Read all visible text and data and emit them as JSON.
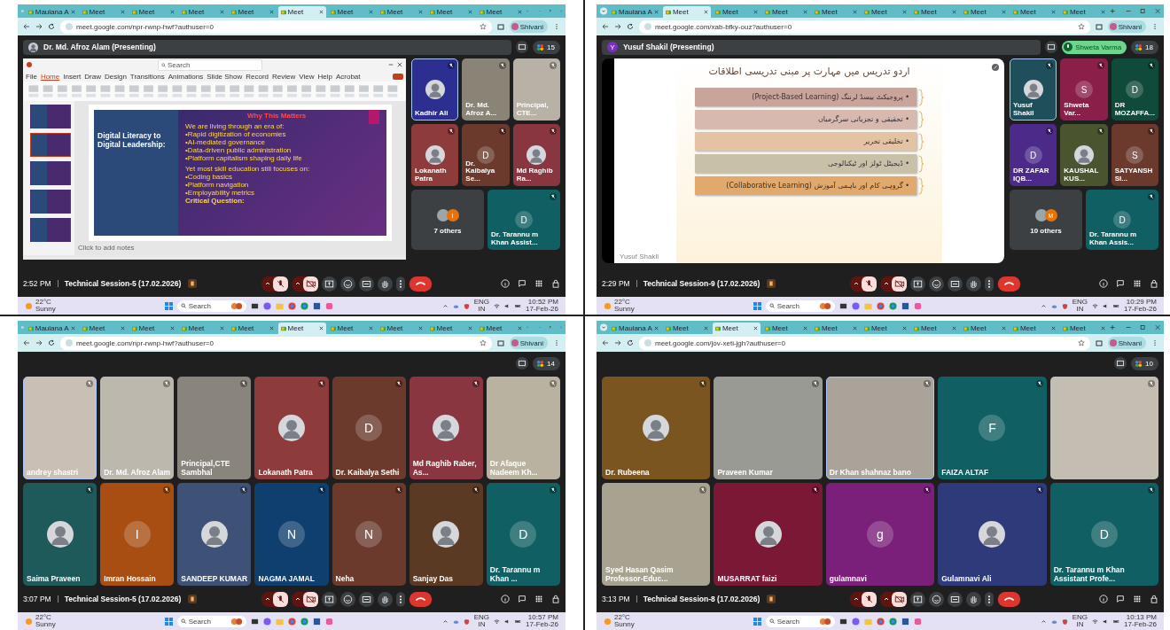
{
  "panels": [
    {
      "tabs": [
        {
          "label": "Maulana A",
          "selected": false
        },
        {
          "label": "Meet",
          "selected": false
        },
        {
          "label": "Meet",
          "selected": false
        },
        {
          "label": "Meet",
          "selected": false
        },
        {
          "label": "Meet",
          "selected": false
        },
        {
          "label": "Meet",
          "selected": true
        },
        {
          "label": "Meet",
          "selected": false
        },
        {
          "label": "Meet",
          "selected": false
        },
        {
          "label": "Meet",
          "selected": false
        },
        {
          "label": "Meet",
          "selected": false
        }
      ],
      "url": "meet.google.com/npr-rwnp-hwf?authuser=0",
      "profile": "Shivani",
      "presenter": "Dr. Md. Afroz Alam (Presenting)",
      "participant_count": "15",
      "presentation": {
        "kind": "powerpoint",
        "search": "Search",
        "ribbon_tabs": [
          {
            "label": "File",
            "selected": false
          },
          {
            "label": "Home",
            "selected": true
          },
          {
            "label": "Insert",
            "selected": false
          },
          {
            "label": "Draw",
            "selected": false
          },
          {
            "label": "Design",
            "selected": false
          },
          {
            "label": "Transitions",
            "selected": false
          },
          {
            "label": "Animations",
            "selected": false
          },
          {
            "label": "Slide Show",
            "selected": false
          },
          {
            "label": "Record",
            "selected": false
          },
          {
            "label": "Review",
            "selected": false
          },
          {
            "label": "View",
            "selected": false
          },
          {
            "label": "Help",
            "selected": false
          },
          {
            "label": "Acrobat",
            "selected": false
          }
        ],
        "thumbnails": [
          {
            "selected": false
          },
          {
            "selected": true
          },
          {
            "selected": false
          },
          {
            "selected": false
          },
          {
            "selected": false
          }
        ],
        "image_title": "Digital Literacy to Digital Leadership:",
        "lines": [
          {
            "kind": "heading",
            "text": "Why This Matters"
          },
          {
            "kind": "lead",
            "text": "We are living through an era of:"
          },
          {
            "kind": "bullet",
            "text": "•Rapid digitization of economies"
          },
          {
            "kind": "bullet",
            "text": "•AI-mediated governance"
          },
          {
            "kind": "bullet",
            "text": "•Data-driven public administration"
          },
          {
            "kind": "bullet",
            "text": "•Platform capitalism shaping daily life"
          },
          {
            "kind": "lead",
            "text": "Yet most skill education still focuses on:"
          },
          {
            "kind": "bullet",
            "text": "•Coding basics"
          },
          {
            "kind": "bullet",
            "text": "•Platform navigation"
          },
          {
            "kind": "bullet",
            "text": "•Employability metrics"
          },
          {
            "kind": "question",
            "text": "Critical Question:"
          }
        ],
        "notes": "Click to add notes"
      },
      "tiles": [
        {
          "name": "Kadhir Ali",
          "kind": "avatar",
          "color": "#2c2f8f",
          "speaking": true
        },
        {
          "name": "Dr. Md. Afroz A...",
          "kind": "video",
          "color": "#8a8477",
          "speaking": false
        },
        {
          "name": "Principal, CTE...",
          "kind": "video",
          "color": "#b8b2a6",
          "speaking": false
        },
        {
          "name": "Lokanath Patra",
          "kind": "avatar",
          "color": "#8e3b3b",
          "speaking": false
        },
        {
          "name": "Dr. Kaibalya Se...",
          "kind": "initial",
          "initial": "D",
          "color": "#6b3a2c",
          "speaking": false
        },
        {
          "name": "Md Raghib Ra...",
          "kind": "avatar",
          "color": "#8a3640",
          "speaking": false
        },
        {
          "name": "7 others",
          "kind": "others",
          "initial": "I",
          "color": "#3c4043",
          "speaking": false
        },
        {
          "name": "Dr. Tarannu m Khan Assist...",
          "kind": "initial",
          "initial": "D",
          "color": "#0f5f63",
          "speaking": false
        }
      ],
      "time": "2:52 PM",
      "meeting_title": "Technical Session-5 (17.02.2026)",
      "taskbar": {
        "temp": "22°C",
        "weather": "Sunny",
        "search": "Search",
        "lang": "ENG",
        "region": "IN",
        "clock": "10:52 PM",
        "date": "17-Feb-26"
      }
    },
    {
      "tabs": [
        {
          "label": "Maulana A",
          "selected": false
        },
        {
          "label": "Meet",
          "selected": true
        },
        {
          "label": "Meet",
          "selected": false
        },
        {
          "label": "Meet",
          "selected": false
        },
        {
          "label": "Meet",
          "selected": false
        },
        {
          "label": "Meet",
          "selected": false
        },
        {
          "label": "Meet",
          "selected": false
        },
        {
          "label": "Meet",
          "selected": false
        },
        {
          "label": "Meet",
          "selected": false
        },
        {
          "label": "Meet",
          "selected": false
        }
      ],
      "url": "meet.google.com/xab-bfky-ouz?authuser=0",
      "profile": "Shivani",
      "presenter": "Yusuf Shakil (Presenting)",
      "presenter_initial": "Y",
      "speaker_pill": "Shweta Varma",
      "participant_count": "18",
      "presentation": {
        "kind": "list_slide",
        "title": "اردو تدریس میں مہارت پر مبنی تدریسی اطلاقات",
        "items": [
          {
            "text": "• پروجیکٹ بیسڈ لرننگ (Project-Based Learning)",
            "color": "#c9a49b"
          },
          {
            "text": "• تحقیقی و تجزیاتی سرگرمیاں",
            "color": "#d8b9b0"
          },
          {
            "text": "• تخلیقی تحریر",
            "color": "#e3c3a3"
          },
          {
            "text": "• ڈیجیٹل ٹولز اور ٹیکنالوجی",
            "color": "#c9c0a8"
          },
          {
            "text": "• گروہی کام اور باہمی آموزش (Collaborative Learning)",
            "color": "#e2a96c"
          }
        ],
        "caption": "Yusuf Shakil"
      },
      "tiles": [
        {
          "name": "Yusuf Shakil",
          "kind": "avatar",
          "color": "#1f4f5a",
          "speaking": true
        },
        {
          "name": "Shweta Var...",
          "kind": "initial",
          "initial": "S",
          "color": "#8a1f4a",
          "speaking": false
        },
        {
          "name": "DR MOZAFFA...",
          "kind": "initial",
          "initial": "D",
          "color": "#0f4a3a",
          "speaking": false
        },
        {
          "name": "DR ZAFAR IQB...",
          "kind": "initial",
          "initial": "D",
          "color": "#4b2a8a",
          "speaking": false
        },
        {
          "name": "KAUSHAL KUS...",
          "kind": "avatar",
          "color": "#4a5530",
          "speaking": false
        },
        {
          "name": "SATYANSH SI...",
          "kind": "initial",
          "initial": "S",
          "color": "#6b3a2c",
          "speaking": false
        },
        {
          "name": "10 others",
          "kind": "others",
          "initial": "M",
          "color": "#3c4043",
          "speaking": false
        },
        {
          "name": "Dr. Tarannu m Khan Assis...",
          "kind": "initial",
          "initial": "D",
          "color": "#0f5f63",
          "speaking": false
        }
      ],
      "time": "2:29 PM",
      "meeting_title": "Technical Session-9 (17.02.2026)",
      "taskbar": {
        "temp": "22°C",
        "weather": "Sunny",
        "search": "Search",
        "lang": "ENG",
        "region": "IN",
        "clock": "10:29 PM",
        "date": "17-Feb-26"
      }
    },
    {
      "tabs": [
        {
          "label": "Maulana A",
          "selected": false
        },
        {
          "label": "Meet",
          "selected": false
        },
        {
          "label": "Meet",
          "selected": false
        },
        {
          "label": "Meet",
          "selected": false
        },
        {
          "label": "Meet",
          "selected": false
        },
        {
          "label": "Meet",
          "selected": true
        },
        {
          "label": "Meet",
          "selected": false
        },
        {
          "label": "Meet",
          "selected": false
        },
        {
          "label": "Meet",
          "selected": false
        },
        {
          "label": "Meet",
          "selected": false
        }
      ],
      "url": "meet.google.com/npr-rwnp-hwf?authuser=0",
      "profile": "Shivani",
      "participant_count": "14",
      "tile_rows": [
        [
          {
            "name": "andrey shastri",
            "kind": "video",
            "color": "#c9bfb5",
            "speaking": true
          },
          {
            "name": "Dr. Md. Afroz Alam",
            "kind": "video",
            "color": "#bdb8ad",
            "speaking": false
          },
          {
            "name": "Principal,CTE Sambhal",
            "kind": "video",
            "color": "#8a857c",
            "speaking": false
          },
          {
            "name": "Lokanath Patra",
            "kind": "avatar",
            "color": "#8e3b3b",
            "speaking": false
          },
          {
            "name": "Dr. Kaibalya Sethi",
            "kind": "initial",
            "initial": "D",
            "color": "#6b3a2c",
            "speaking": false
          },
          {
            "name": "Md Raghib Raber, As...",
            "kind": "avatar",
            "color": "#8a3640",
            "speaking": false
          },
          {
            "name": "Dr Afaque Nadeem Kh...",
            "kind": "video",
            "color": "#b9b2a0",
            "speaking": false
          }
        ],
        [
          {
            "name": "Saima Praveen",
            "kind": "avatar",
            "color": "#1f5a5a",
            "speaking": false
          },
          {
            "name": "Imran Hossain",
            "kind": "initial",
            "initial": "I",
            "color": "#a84e12",
            "speaking": false
          },
          {
            "name": "SANDEEP KUMAR",
            "kind": "avatar",
            "color": "#3e5277",
            "speaking": false
          },
          {
            "name": "NAGMA JAMAL",
            "kind": "initial",
            "initial": "N",
            "color": "#0f3f6e",
            "speaking": false
          },
          {
            "name": "Neha",
            "kind": "initial",
            "initial": "N",
            "color": "#6b3a2c",
            "speaking": false
          },
          {
            "name": "Sanjay Das",
            "kind": "avatar",
            "color": "#5a3a22",
            "speaking": false
          },
          {
            "name": "Dr. Tarannu m Khan ...",
            "kind": "initial",
            "initial": "D",
            "color": "#0f5f63",
            "speaking": false
          }
        ]
      ],
      "time": "3:07 PM",
      "meeting_title": "Technical Session-5 (17.02.2026)",
      "taskbar": {
        "temp": "22°C",
        "weather": "Sunny",
        "search": "Search",
        "lang": "ENG",
        "region": "IN",
        "clock": "10:57 PM",
        "date": "17-Feb-26"
      }
    },
    {
      "tabs": [
        {
          "label": "Maulana A",
          "selected": false
        },
        {
          "label": "Meet",
          "selected": false
        },
        {
          "label": "Meet",
          "selected": true
        },
        {
          "label": "Meet",
          "selected": false
        },
        {
          "label": "Meet",
          "selected": false
        },
        {
          "label": "Meet",
          "selected": false
        },
        {
          "label": "Meet",
          "selected": false
        },
        {
          "label": "Meet",
          "selected": false
        },
        {
          "label": "Meet",
          "selected": false
        },
        {
          "label": "Meet",
          "selected": false
        }
      ],
      "url": "meet.google.com/jov-xeti-jgh?authuser=0",
      "profile": "Shivani",
      "participant_count": "10",
      "tile_rows": [
        [
          {
            "name": "Dr. Rubeena",
            "kind": "avatar",
            "color": "#7a5520",
            "speaking": false
          },
          {
            "name": "Praveen Kumar",
            "kind": "video",
            "color": "#9a9a95",
            "speaking": false
          },
          {
            "name": "Dr Khan shahnaz bano",
            "kind": "video",
            "color": "#a9a39a",
            "speaking": true
          },
          {
            "name": "FAIZA ALTAF",
            "kind": "initial",
            "initial": "F",
            "color": "#0f5f63",
            "speaking": false
          },
          {
            "kind": "video",
            "color": "#c4bdb2",
            "speaking": false
          }
        ],
        [
          {
            "name": "Syed Hasan Qasim Professor-Educ...",
            "kind": "video",
            "color": "#a8a290",
            "speaking": false
          },
          {
            "name": "MUSARRAT faizi",
            "kind": "avatar",
            "color": "#7a1836",
            "speaking": false
          },
          {
            "name": "gulamnavi",
            "kind": "initial",
            "initial": "g",
            "color": "#7a1f7a",
            "speaking": false
          },
          {
            "name": "Gulamnavi Ali",
            "kind": "avatar",
            "color": "#2e3a7a",
            "speaking": false
          },
          {
            "name": "Dr. Tarannu m Khan Assistant Profe...",
            "kind": "initial",
            "initial": "D",
            "color": "#0f5f63",
            "speaking": false
          }
        ]
      ],
      "time": "3:13 PM",
      "meeting_title": "Technical Session-8 (17.02.2026)",
      "taskbar": {
        "temp": "22°C",
        "weather": "Sunny",
        "search": "Search",
        "lang": "ENG",
        "region": "IN",
        "clock": "10:13 PM",
        "date": "17-Feb-26"
      }
    }
  ]
}
